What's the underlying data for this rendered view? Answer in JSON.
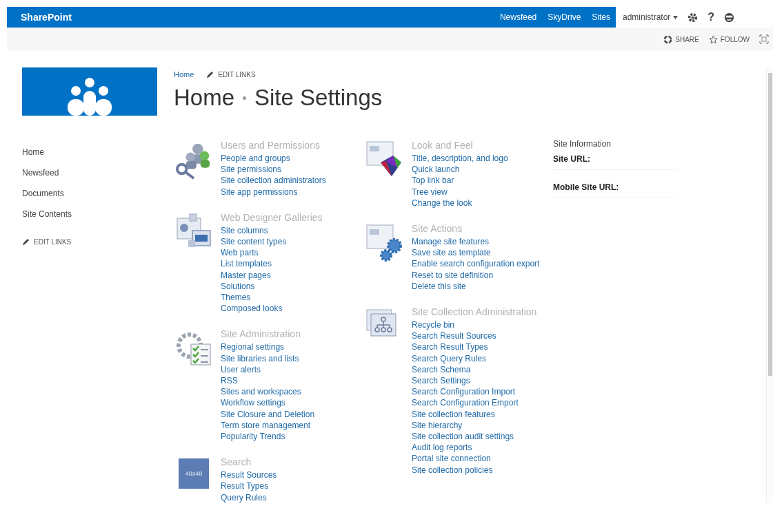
{
  "suite_bar": {
    "brand": "SharePoint",
    "links": [
      "Newsfeed",
      "SkyDrive",
      "Sites"
    ],
    "user": "administrator",
    "help": "?"
  },
  "actions": [
    "SHARE",
    "FOLLOW"
  ],
  "breadcrumb": {
    "link": "Home",
    "edit": "EDIT LINKS"
  },
  "title": {
    "parent": "Home",
    "current": "Site Settings"
  },
  "left_nav": {
    "items": [
      "Home",
      "Newsfeed",
      "Documents",
      "Site Contents"
    ],
    "edit": "EDIT LINKS"
  },
  "columns": [
    [
      {
        "kind": "icon",
        "title": "Users and Permissions",
        "links": [
          "People and groups",
          "Site permissions",
          "Site collection administrators",
          "Site app permissions"
        ]
      },
      {
        "kind": "icon",
        "title": "Web Designer Galleries",
        "links": [
          "Site columns",
          "Site content types",
          "Web parts",
          "List templates",
          "Master pages",
          "Solutions",
          "Themes",
          "Composed looks"
        ]
      },
      {
        "kind": "icon",
        "title": "Site Administration",
        "links": [
          "Regional settings",
          "Site libraries and lists",
          "User alerts",
          "RSS",
          "Sites and workspaces",
          "Workflow settings",
          "Site Closure and Deletion",
          "Term store management",
          "Popularity Trends"
        ]
      },
      {
        "kind": "placeholder",
        "icon_text": "48x48",
        "title": "Search",
        "links": [
          "Result Sources",
          "Result Types",
          "Query Rules"
        ]
      }
    ],
    [
      {
        "kind": "icon",
        "title": "Look and Feel",
        "links": [
          "Title, description, and logo",
          "Quick launch",
          "Top link bar",
          "Tree view",
          "Change the look"
        ]
      },
      {
        "kind": "icon",
        "title": "Site Actions",
        "links": [
          "Manage site features",
          "Save site as template",
          "Enable search configuration export",
          "Reset to site definition",
          "Delete this site"
        ]
      },
      {
        "kind": "icon",
        "title": "Site Collection Administration",
        "links": [
          "Recycle bin",
          "Search Result Sources",
          "Search Result Types",
          "Search Query Rules",
          "Search Schema",
          "Search Settings",
          "Search Configuration Import",
          "Search Configuration Emport",
          "Site collection features",
          "Site hierarchy",
          "Site collection audit settings",
          "Audit log reports",
          "Portal site connection",
          "Site collection policies"
        ]
      }
    ]
  ],
  "site_info": {
    "title": "Site Information",
    "fields": [
      "Site URL:",
      "Mobile Site URL:"
    ]
  }
}
